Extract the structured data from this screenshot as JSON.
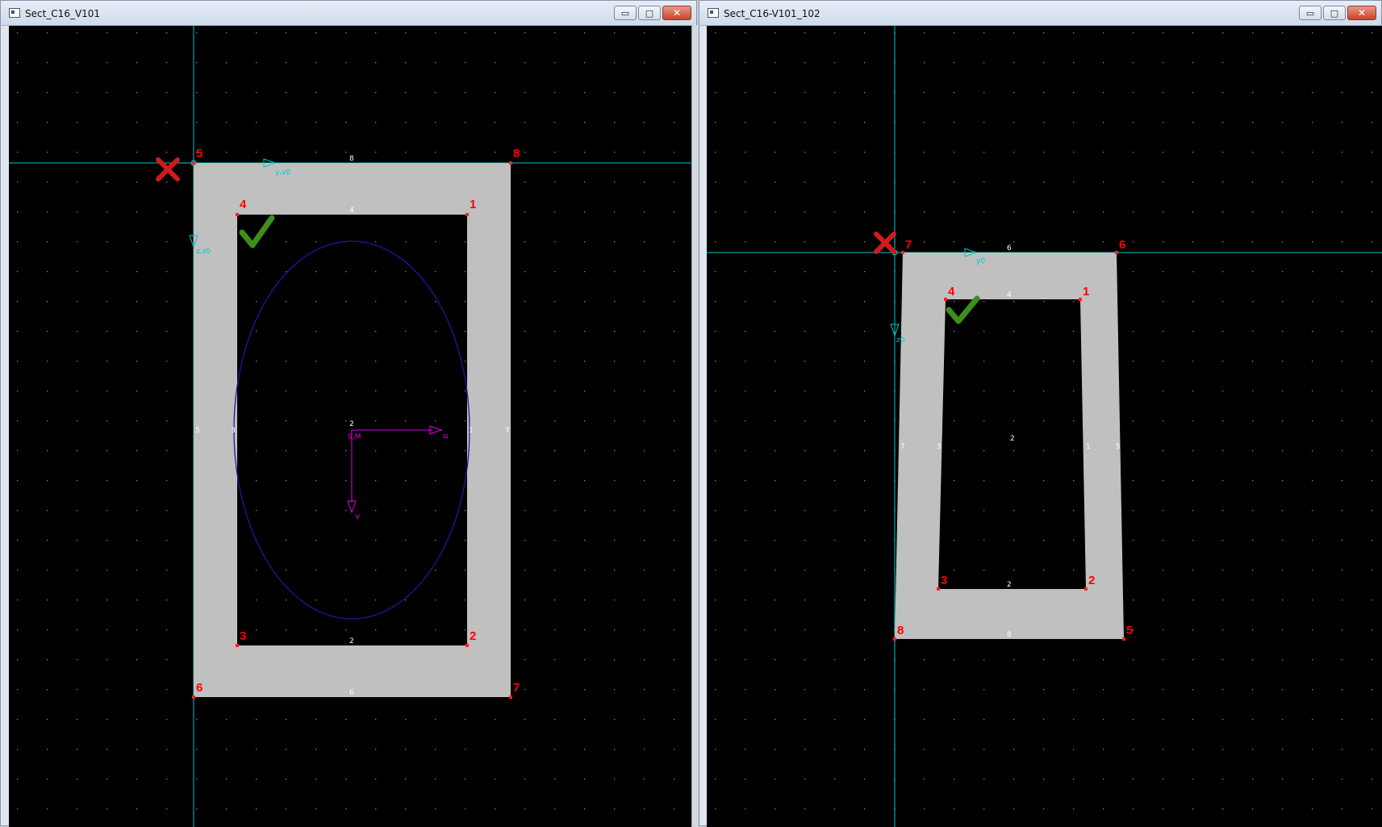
{
  "windows": [
    {
      "title": "Sect_C16_V101",
      "buttons": {
        "minimize": "▭",
        "maximize": "□",
        "close": "✕"
      },
      "outer_corner_labels": [
        "5",
        "8",
        "7",
        "6"
      ],
      "inner_corner_labels": [
        "4",
        "1",
        "2",
        "3"
      ],
      "edge_labels": [
        "8",
        "4",
        "5",
        "3",
        "1",
        "7",
        "2",
        "6"
      ],
      "axis_labels": {
        "y": "y,v0",
        "z": "z,z0"
      },
      "principal_axes": {
        "u": "u",
        "v": "v",
        "origin": "S,M",
        "centroid": "2"
      },
      "markers": {
        "error": "red-x-icon",
        "check": "green-check-icon"
      }
    },
    {
      "title": "Sect_C16-V101_102",
      "buttons": {
        "minimize": "▭",
        "maximize": "□",
        "close": "✕"
      },
      "outer_corner_labels": [
        "7",
        "6",
        "5",
        "8"
      ],
      "inner_corner_labels": [
        "4",
        "1",
        "2",
        "3"
      ],
      "edge_labels": [
        "6",
        "4",
        "7",
        "3",
        "1",
        "5",
        "2",
        "8"
      ],
      "axis_labels": {
        "y": "y0",
        "z": "z0"
      },
      "centroid": "2",
      "markers": {
        "error": "red-x-icon",
        "check": "green-check-icon"
      }
    }
  ],
  "colors": {
    "background": "#000000",
    "section_fill": "#c0c0c0",
    "node_label": "#ff0000",
    "edge_label": "#ffffff",
    "axis": "#00c8c8",
    "principal_axis": "#e000e0",
    "ellipse": "#1a1aa0",
    "error_mark": "#d21a1a",
    "check_mark": "#3e8e1e"
  }
}
